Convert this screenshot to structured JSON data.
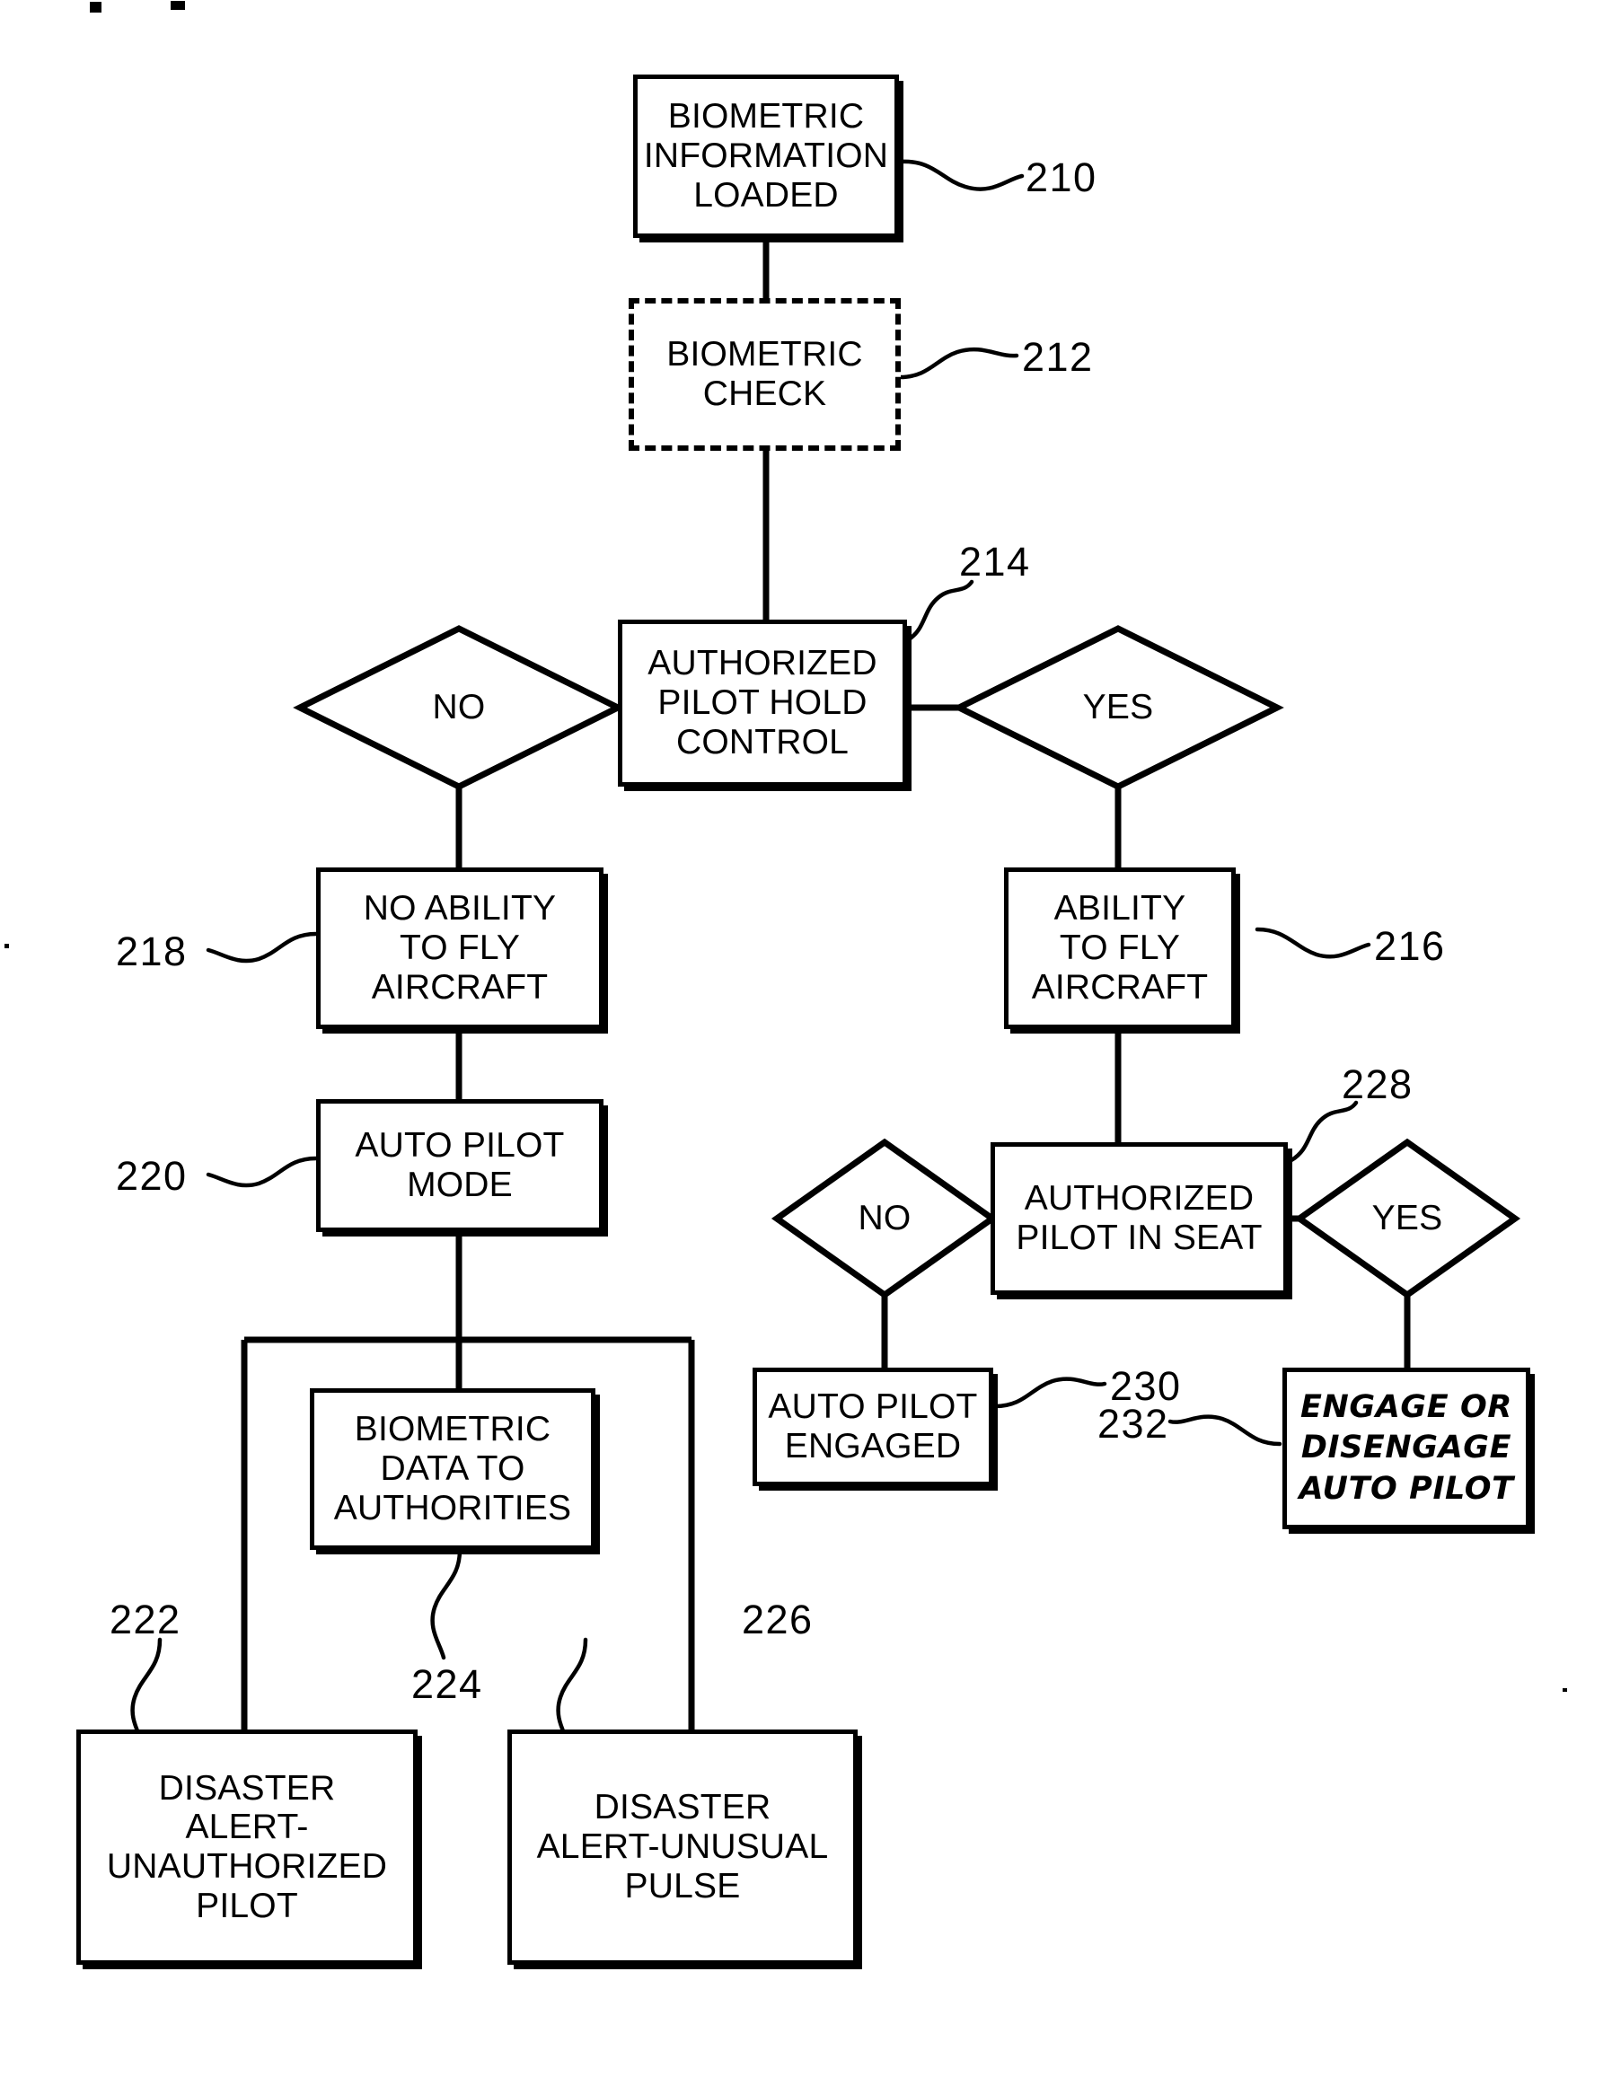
{
  "figure": {
    "type": "patent-flowchart",
    "title": "Biometric pilot authorization and auto pilot control flow"
  },
  "nodes": {
    "n210": {
      "text": "BIOMETRIC\nINFORMATION\nLOADED",
      "ref": "210",
      "style": "solid"
    },
    "n212": {
      "text": "BIOMETRIC\nCHECK",
      "ref": "212",
      "style": "dashed"
    },
    "n214": {
      "text": "AUTHORIZED\nPILOT HOLD\nCONTROL",
      "ref": "214",
      "style": "solid"
    },
    "n216": {
      "text": "ABILITY\nTO FLY\nAIRCRAFT",
      "ref": "216",
      "style": "solid"
    },
    "n218": {
      "text": "NO ABILITY\nTO FLY\nAIRCRAFT",
      "ref": "218",
      "style": "solid"
    },
    "n220": {
      "text": "AUTO PILOT\nMODE",
      "ref": "220",
      "style": "solid"
    },
    "n222": {
      "text": "DISASTER\nALERT-\nUNAUTHORIZED\nPILOT",
      "ref": "222",
      "style": "solid"
    },
    "n224": {
      "text": "BIOMETRIC\nDATA TO\nAUTHORITIES",
      "ref": "224",
      "style": "solid"
    },
    "n226": {
      "text": "DISASTER\nALERT-UNUSUAL\nPULSE",
      "ref": "226",
      "style": "solid"
    },
    "n228": {
      "text": "AUTHORIZED\nPILOT IN SEAT",
      "ref": "228",
      "style": "solid"
    },
    "n230": {
      "text": "AUTO PILOT\nENGAGED",
      "ref": "230",
      "style": "solid"
    },
    "n232": {
      "text": "ENGAGE OR\nDISENGAGE\nAUTO PILOT",
      "ref": "232",
      "style": "solid-handwritten"
    }
  },
  "decisions": {
    "d214_no": {
      "text": "NO"
    },
    "d214_yes": {
      "text": "YES"
    },
    "d228_no": {
      "text": "NO"
    },
    "d228_yes": {
      "text": "YES"
    }
  },
  "refs": {
    "r210": "210",
    "r212": "212",
    "r214": "214",
    "r216": "216",
    "r218": "218",
    "r220": "220",
    "r222": "222",
    "r224": "224",
    "r226": "226",
    "r228": "228",
    "r230": "230",
    "r232": "232"
  },
  "colors": {
    "ink": "#000000",
    "paper": "#ffffff"
  }
}
